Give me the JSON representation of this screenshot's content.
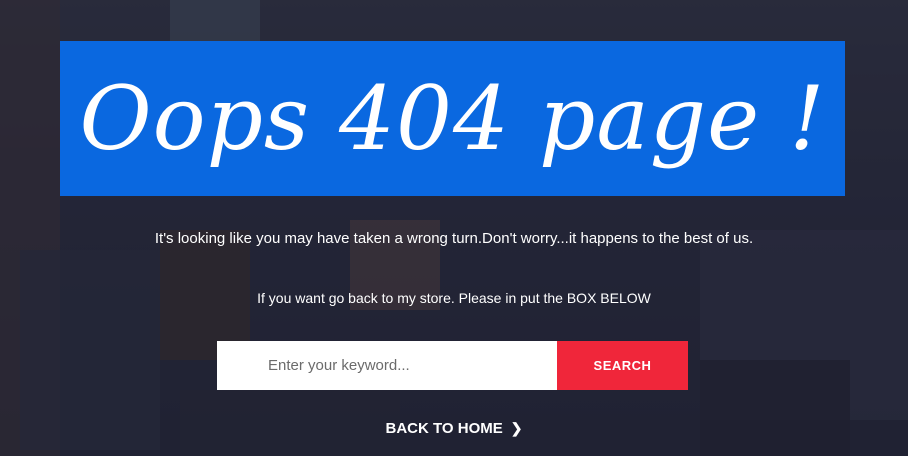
{
  "banner": {
    "title": "Oops 404 page !",
    "color": "#0a68e0"
  },
  "message": {
    "line1": "It's looking like you may have taken a wrong turn.Don't worry...it happens to the best of us.",
    "line2": "If you want go back to my store. Please in put the BOX BELOW"
  },
  "search": {
    "placeholder": "Enter your keyword...",
    "value": "",
    "button_label": "SEARCH",
    "button_color": "#f0263a"
  },
  "back_home": {
    "label": "BACK TO HOME",
    "icon": "chevron-right-icon"
  },
  "background": {
    "icon": "store-background-image"
  }
}
